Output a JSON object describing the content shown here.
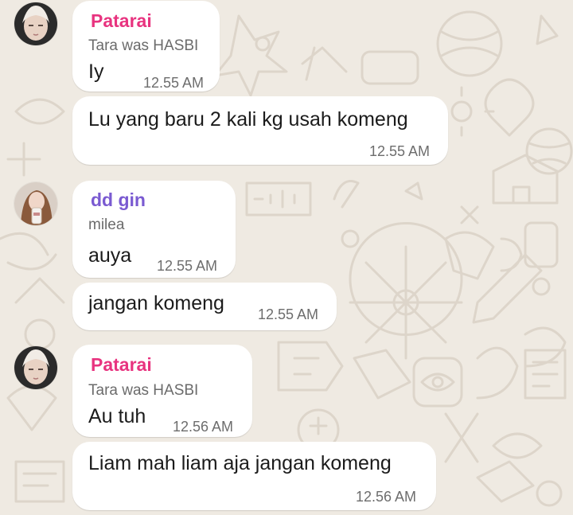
{
  "theme": {
    "background": "#efeae2",
    "doodle_color": "#e0d9cf",
    "bubble_color": "#ffffff",
    "sender_pink": "#e8337f",
    "sender_purple": "#7a5ad1"
  },
  "chat": {
    "messages": [
      {
        "sender": "Patarai",
        "quoted_text": "Tara was HASBI",
        "text": "Iy",
        "time": "12.55 AM"
      },
      {
        "text": "Lu yang baru 2 kali kg usah komeng",
        "time": "12.55 AM"
      },
      {
        "sender": "dd gin",
        "quoted_text": "milea",
        "text": "auya",
        "time": "12.55 AM"
      },
      {
        "text": "jangan komeng",
        "time": "12.55 AM"
      },
      {
        "sender": "Patarai",
        "quoted_text": "Tara was HASBI",
        "text": "Au tuh",
        "time": "12.56 AM"
      },
      {
        "text": "Liam mah liam aja jangan komeng",
        "time": "12.56 AM"
      }
    ]
  }
}
